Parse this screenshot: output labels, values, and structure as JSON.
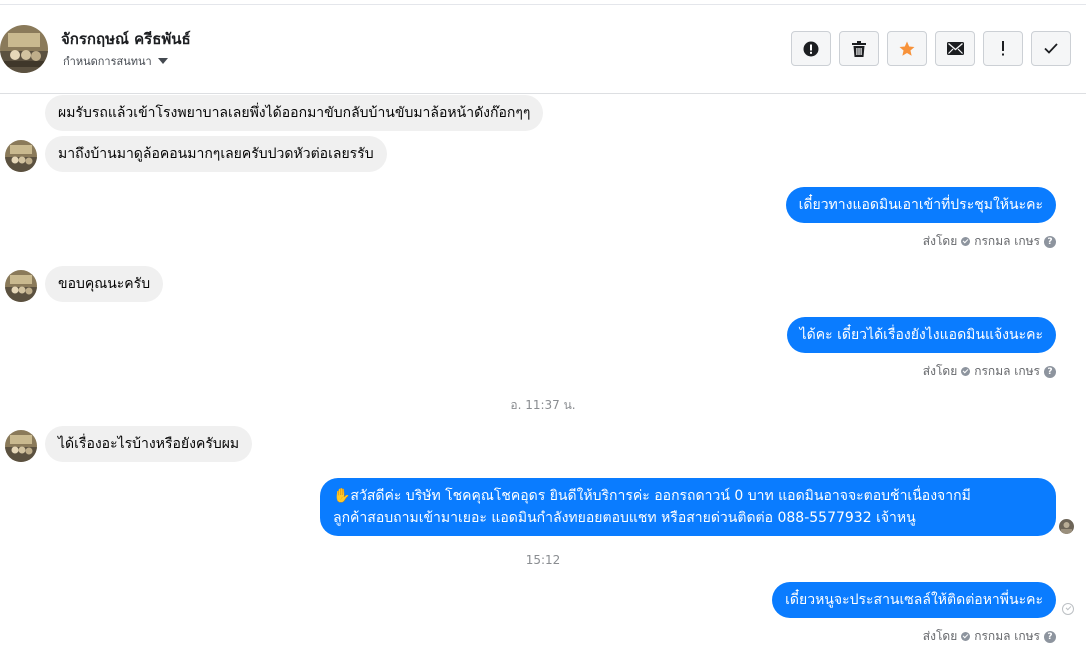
{
  "header": {
    "contact_name": "จักรกฤษณ์ ครีธพันธ์",
    "assign_label": "กำหนดการสนทนา",
    "actions": [
      {
        "icon": "alert-circle-icon",
        "label": "report"
      },
      {
        "icon": "trash-icon",
        "label": "delete"
      },
      {
        "icon": "star-icon",
        "label": "star"
      },
      {
        "icon": "envelope-icon",
        "label": "mark unread"
      },
      {
        "icon": "exclamation-icon",
        "label": "important"
      },
      {
        "icon": "check-icon",
        "label": "done"
      }
    ]
  },
  "messages": [
    {
      "side": "in",
      "text": "ผมรับรถแล้วเข้าโรงพยาบาลเลยพึ่งได้ออกมาขับกลับบ้านขับมาล้อหน้าดังก๊อกๆๆ"
    },
    {
      "side": "in",
      "text": "มาถึงบ้านมาดูล้อคอนมากๆเลยครับปวดหัวต่อเลยรรับ"
    },
    {
      "side": "out",
      "text": "เดี๋ยวทางแอดมินเอาเข้าที่ประชุมให้นะคะ",
      "sent_by": "ส่งโดย",
      "sender": "กรกมล เกษร"
    },
    {
      "side": "in",
      "text": "ขอบคุณนะครับ"
    },
    {
      "side": "out",
      "text": "ได้คะ เดี๋ยวได้เรื่องยังไงแอดมินแจ้งนะคะ",
      "sent_by": "ส่งโดย",
      "sender": "กรกมล เกษร"
    },
    {
      "side": "time",
      "text": "อ. 11:37 น."
    },
    {
      "side": "in",
      "text": "ได้เรื่องอะไรบ้างหรือยังครับผม"
    },
    {
      "side": "out",
      "text_line1": "✋สวัสดีค่ะ บริษัท โชคคุณโชคอุดร ยินดีให้บริการค่ะ ออกรถดาวน์ 0 บาท แอดมินอาจจะตอบช้าเนื่องจากมี",
      "text_line2": "ลูกค้าสอบถามเข้ามาเยอะ แอดมินกำลังทยอยตอบแชท หรือสายด่วนติดต่อ 088-5577932 เจ้าหนู"
    },
    {
      "side": "time",
      "text": "15:12"
    },
    {
      "side": "out",
      "text": "เดี๋ยวหนูจะประสานเซลล์ให้ติดต่อหาพี่นะคะ",
      "sent_by": "ส่งโดย",
      "sender": "กรกมล เกษร"
    }
  ],
  "colors": {
    "outgoing_bubble": "#0a7cff",
    "incoming_bubble": "#f0f0f0",
    "star": "#f7923a"
  }
}
